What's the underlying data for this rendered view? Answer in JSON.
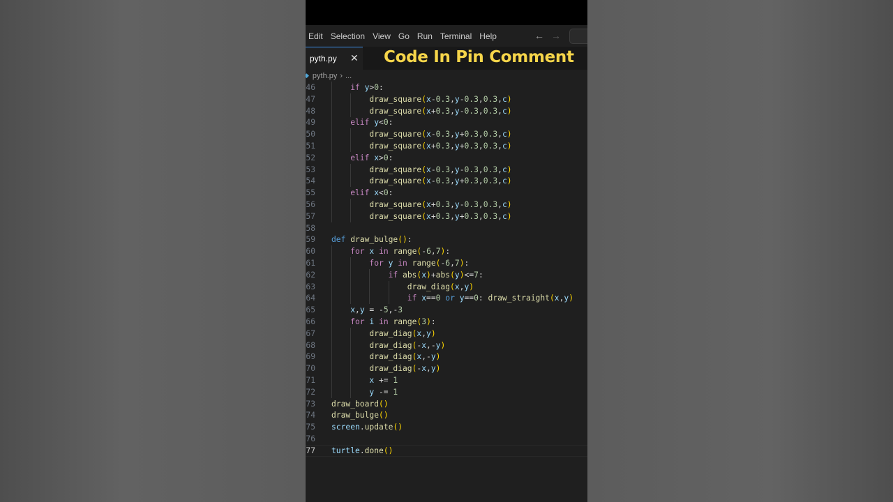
{
  "menu": [
    "Edit",
    "Selection",
    "View",
    "Go",
    "Run",
    "Terminal",
    "Help"
  ],
  "nav": {
    "back_icon": "arrow-left-icon",
    "forward_icon": "arrow-right-icon"
  },
  "tab": {
    "label": "pyth.py",
    "close_glyph": "✕"
  },
  "overlay_text": "Code In Pin Comment",
  "breadcrumb": {
    "file": "pyth.py",
    "more": "..."
  },
  "editor": {
    "current_line": 77,
    "lines": [
      {
        "n": 46,
        "indent": 1,
        "tokens": [
          [
            "kw",
            "if"
          ],
          [
            "op",
            " "
          ],
          [
            "var",
            "y"
          ],
          [
            "op",
            ">"
          ],
          [
            "num",
            "0"
          ],
          [
            "op",
            ":"
          ]
        ]
      },
      {
        "n": 47,
        "indent": 2,
        "tokens": [
          [
            "fn",
            "draw_square"
          ],
          [
            "par",
            "("
          ],
          [
            "var",
            "x"
          ],
          [
            "op",
            "-"
          ],
          [
            "num",
            "0.3"
          ],
          [
            "op",
            ","
          ],
          [
            "var",
            "y"
          ],
          [
            "op",
            "-"
          ],
          [
            "num",
            "0.3"
          ],
          [
            "op",
            ","
          ],
          [
            "num",
            "0.3"
          ],
          [
            "op",
            ","
          ],
          [
            "var",
            "c"
          ],
          [
            "par",
            ")"
          ]
        ]
      },
      {
        "n": 48,
        "indent": 2,
        "tokens": [
          [
            "fn",
            "draw_square"
          ],
          [
            "par",
            "("
          ],
          [
            "var",
            "x"
          ],
          [
            "op",
            "+"
          ],
          [
            "num",
            "0.3"
          ],
          [
            "op",
            ","
          ],
          [
            "var",
            "y"
          ],
          [
            "op",
            "-"
          ],
          [
            "num",
            "0.3"
          ],
          [
            "op",
            ","
          ],
          [
            "num",
            "0.3"
          ],
          [
            "op",
            ","
          ],
          [
            "var",
            "c"
          ],
          [
            "par",
            ")"
          ]
        ]
      },
      {
        "n": 49,
        "indent": 1,
        "tokens": [
          [
            "kw",
            "elif"
          ],
          [
            "op",
            " "
          ],
          [
            "var",
            "y"
          ],
          [
            "op",
            "<"
          ],
          [
            "num",
            "0"
          ],
          [
            "op",
            ":"
          ]
        ]
      },
      {
        "n": 50,
        "indent": 2,
        "tokens": [
          [
            "fn",
            "draw_square"
          ],
          [
            "par",
            "("
          ],
          [
            "var",
            "x"
          ],
          [
            "op",
            "-"
          ],
          [
            "num",
            "0.3"
          ],
          [
            "op",
            ","
          ],
          [
            "var",
            "y"
          ],
          [
            "op",
            "+"
          ],
          [
            "num",
            "0.3"
          ],
          [
            "op",
            ","
          ],
          [
            "num",
            "0.3"
          ],
          [
            "op",
            ","
          ],
          [
            "var",
            "c"
          ],
          [
            "par",
            ")"
          ]
        ]
      },
      {
        "n": 51,
        "indent": 2,
        "tokens": [
          [
            "fn",
            "draw_square"
          ],
          [
            "par",
            "("
          ],
          [
            "var",
            "x"
          ],
          [
            "op",
            "+"
          ],
          [
            "num",
            "0.3"
          ],
          [
            "op",
            ","
          ],
          [
            "var",
            "y"
          ],
          [
            "op",
            "+"
          ],
          [
            "num",
            "0.3"
          ],
          [
            "op",
            ","
          ],
          [
            "num",
            "0.3"
          ],
          [
            "op",
            ","
          ],
          [
            "var",
            "c"
          ],
          [
            "par",
            ")"
          ]
        ]
      },
      {
        "n": 52,
        "indent": 1,
        "tokens": [
          [
            "kw",
            "elif"
          ],
          [
            "op",
            " "
          ],
          [
            "var",
            "x"
          ],
          [
            "op",
            ">"
          ],
          [
            "num",
            "0"
          ],
          [
            "op",
            ":"
          ]
        ]
      },
      {
        "n": 53,
        "indent": 2,
        "tokens": [
          [
            "fn",
            "draw_square"
          ],
          [
            "par",
            "("
          ],
          [
            "var",
            "x"
          ],
          [
            "op",
            "-"
          ],
          [
            "num",
            "0.3"
          ],
          [
            "op",
            ","
          ],
          [
            "var",
            "y"
          ],
          [
            "op",
            "-"
          ],
          [
            "num",
            "0.3"
          ],
          [
            "op",
            ","
          ],
          [
            "num",
            "0.3"
          ],
          [
            "op",
            ","
          ],
          [
            "var",
            "c"
          ],
          [
            "par",
            ")"
          ]
        ]
      },
      {
        "n": 54,
        "indent": 2,
        "tokens": [
          [
            "fn",
            "draw_square"
          ],
          [
            "par",
            "("
          ],
          [
            "var",
            "x"
          ],
          [
            "op",
            "-"
          ],
          [
            "num",
            "0.3"
          ],
          [
            "op",
            ","
          ],
          [
            "var",
            "y"
          ],
          [
            "op",
            "+"
          ],
          [
            "num",
            "0.3"
          ],
          [
            "op",
            ","
          ],
          [
            "num",
            "0.3"
          ],
          [
            "op",
            ","
          ],
          [
            "var",
            "c"
          ],
          [
            "par",
            ")"
          ]
        ]
      },
      {
        "n": 55,
        "indent": 1,
        "tokens": [
          [
            "kw",
            "elif"
          ],
          [
            "op",
            " "
          ],
          [
            "var",
            "x"
          ],
          [
            "op",
            "<"
          ],
          [
            "num",
            "0"
          ],
          [
            "op",
            ":"
          ]
        ]
      },
      {
        "n": 56,
        "indent": 2,
        "tokens": [
          [
            "fn",
            "draw_square"
          ],
          [
            "par",
            "("
          ],
          [
            "var",
            "x"
          ],
          [
            "op",
            "+"
          ],
          [
            "num",
            "0.3"
          ],
          [
            "op",
            ","
          ],
          [
            "var",
            "y"
          ],
          [
            "op",
            "-"
          ],
          [
            "num",
            "0.3"
          ],
          [
            "op",
            ","
          ],
          [
            "num",
            "0.3"
          ],
          [
            "op",
            ","
          ],
          [
            "var",
            "c"
          ],
          [
            "par",
            ")"
          ]
        ]
      },
      {
        "n": 57,
        "indent": 2,
        "tokens": [
          [
            "fn",
            "draw_square"
          ],
          [
            "par",
            "("
          ],
          [
            "var",
            "x"
          ],
          [
            "op",
            "+"
          ],
          [
            "num",
            "0.3"
          ],
          [
            "op",
            ","
          ],
          [
            "var",
            "y"
          ],
          [
            "op",
            "+"
          ],
          [
            "num",
            "0.3"
          ],
          [
            "op",
            ","
          ],
          [
            "num",
            "0.3"
          ],
          [
            "op",
            ","
          ],
          [
            "var",
            "c"
          ],
          [
            "par",
            ")"
          ]
        ]
      },
      {
        "n": 58,
        "indent": 0,
        "tokens": []
      },
      {
        "n": 59,
        "indent": 0,
        "tokens": [
          [
            "def",
            "def"
          ],
          [
            "op",
            " "
          ],
          [
            "fn",
            "draw_bulge"
          ],
          [
            "par",
            "()"
          ],
          [
            "op",
            ":"
          ]
        ]
      },
      {
        "n": 60,
        "indent": 1,
        "tokens": [
          [
            "kw",
            "for"
          ],
          [
            "op",
            " "
          ],
          [
            "var",
            "x"
          ],
          [
            "op",
            " "
          ],
          [
            "kw",
            "in"
          ],
          [
            "op",
            " "
          ],
          [
            "fn",
            "range"
          ],
          [
            "par",
            "("
          ],
          [
            "op",
            "-"
          ],
          [
            "num",
            "6"
          ],
          [
            "op",
            ","
          ],
          [
            "num",
            "7"
          ],
          [
            "par",
            ")"
          ],
          [
            "op",
            ":"
          ]
        ]
      },
      {
        "n": 61,
        "indent": 2,
        "tokens": [
          [
            "kw",
            "for"
          ],
          [
            "op",
            " "
          ],
          [
            "var",
            "y"
          ],
          [
            "op",
            " "
          ],
          [
            "kw",
            "in"
          ],
          [
            "op",
            " "
          ],
          [
            "fn",
            "range"
          ],
          [
            "par",
            "("
          ],
          [
            "op",
            "-"
          ],
          [
            "num",
            "6"
          ],
          [
            "op",
            ","
          ],
          [
            "num",
            "7"
          ],
          [
            "par",
            ")"
          ],
          [
            "op",
            ":"
          ]
        ]
      },
      {
        "n": 62,
        "indent": 3,
        "tokens": [
          [
            "kw",
            "if"
          ],
          [
            "op",
            " "
          ],
          [
            "fn",
            "abs"
          ],
          [
            "par",
            "("
          ],
          [
            "var",
            "x"
          ],
          [
            "par",
            ")"
          ],
          [
            "op",
            "+"
          ],
          [
            "fn",
            "abs"
          ],
          [
            "par",
            "("
          ],
          [
            "var",
            "y"
          ],
          [
            "par",
            ")"
          ],
          [
            "op",
            "<="
          ],
          [
            "num",
            "7"
          ],
          [
            "op",
            ":"
          ]
        ]
      },
      {
        "n": 63,
        "indent": 4,
        "tokens": [
          [
            "fn",
            "draw_diag"
          ],
          [
            "par",
            "("
          ],
          [
            "var",
            "x"
          ],
          [
            "op",
            ","
          ],
          [
            "var",
            "y"
          ],
          [
            "par",
            ")"
          ]
        ]
      },
      {
        "n": 64,
        "indent": 4,
        "tokens": [
          [
            "kw",
            "if"
          ],
          [
            "op",
            " "
          ],
          [
            "var",
            "x"
          ],
          [
            "op",
            "=="
          ],
          [
            "num",
            "0"
          ],
          [
            "op",
            " "
          ],
          [
            "def",
            "or"
          ],
          [
            "op",
            " "
          ],
          [
            "var",
            "y"
          ],
          [
            "op",
            "=="
          ],
          [
            "num",
            "0"
          ],
          [
            "op",
            ": "
          ],
          [
            "fn",
            "draw_straight"
          ],
          [
            "par",
            "("
          ],
          [
            "var",
            "x"
          ],
          [
            "op",
            ","
          ],
          [
            "var",
            "y"
          ],
          [
            "par",
            ")"
          ]
        ]
      },
      {
        "n": 65,
        "indent": 1,
        "tokens": [
          [
            "var",
            "x"
          ],
          [
            "op",
            ","
          ],
          [
            "var",
            "y"
          ],
          [
            "op",
            " = -"
          ],
          [
            "num",
            "5"
          ],
          [
            "op",
            ",-"
          ],
          [
            "num",
            "3"
          ]
        ]
      },
      {
        "n": 66,
        "indent": 1,
        "tokens": [
          [
            "kw",
            "for"
          ],
          [
            "op",
            " "
          ],
          [
            "var",
            "i"
          ],
          [
            "op",
            " "
          ],
          [
            "kw",
            "in"
          ],
          [
            "op",
            " "
          ],
          [
            "fn",
            "range"
          ],
          [
            "par",
            "("
          ],
          [
            "num",
            "3"
          ],
          [
            "par",
            ")"
          ],
          [
            "op",
            ":"
          ]
        ]
      },
      {
        "n": 67,
        "indent": 2,
        "tokens": [
          [
            "fn",
            "draw_diag"
          ],
          [
            "par",
            "("
          ],
          [
            "var",
            "x"
          ],
          [
            "op",
            ","
          ],
          [
            "var",
            "y"
          ],
          [
            "par",
            ")"
          ]
        ]
      },
      {
        "n": 68,
        "indent": 2,
        "tokens": [
          [
            "fn",
            "draw_diag"
          ],
          [
            "par",
            "("
          ],
          [
            "op",
            "-"
          ],
          [
            "var",
            "x"
          ],
          [
            "op",
            ",-"
          ],
          [
            "var",
            "y"
          ],
          [
            "par",
            ")"
          ]
        ]
      },
      {
        "n": 69,
        "indent": 2,
        "tokens": [
          [
            "fn",
            "draw_diag"
          ],
          [
            "par",
            "("
          ],
          [
            "var",
            "x"
          ],
          [
            "op",
            ",-"
          ],
          [
            "var",
            "y"
          ],
          [
            "par",
            ")"
          ]
        ]
      },
      {
        "n": 70,
        "indent": 2,
        "tokens": [
          [
            "fn",
            "draw_diag"
          ],
          [
            "par",
            "("
          ],
          [
            "op",
            "-"
          ],
          [
            "var",
            "x"
          ],
          [
            "op",
            ","
          ],
          [
            "var",
            "y"
          ],
          [
            "par",
            ")"
          ]
        ]
      },
      {
        "n": 71,
        "indent": 2,
        "tokens": [
          [
            "var",
            "x"
          ],
          [
            "op",
            " += "
          ],
          [
            "num",
            "1"
          ]
        ]
      },
      {
        "n": 72,
        "indent": 2,
        "tokens": [
          [
            "var",
            "y"
          ],
          [
            "op",
            " -= "
          ],
          [
            "num",
            "1"
          ]
        ]
      },
      {
        "n": 73,
        "indent": 0,
        "tokens": [
          [
            "fn",
            "draw_board"
          ],
          [
            "par",
            "()"
          ]
        ]
      },
      {
        "n": 74,
        "indent": 0,
        "tokens": [
          [
            "fn",
            "draw_bulge"
          ],
          [
            "par",
            "()"
          ]
        ]
      },
      {
        "n": 75,
        "indent": 0,
        "tokens": [
          [
            "var",
            "screen"
          ],
          [
            "op",
            "."
          ],
          [
            "fn",
            "update"
          ],
          [
            "par",
            "()"
          ]
        ]
      },
      {
        "n": 76,
        "indent": 0,
        "tokens": []
      },
      {
        "n": 77,
        "indent": 0,
        "tokens": [
          [
            "var",
            "turtle"
          ],
          [
            "op",
            "."
          ],
          [
            "fn",
            "done"
          ],
          [
            "par",
            "()"
          ]
        ]
      }
    ]
  }
}
